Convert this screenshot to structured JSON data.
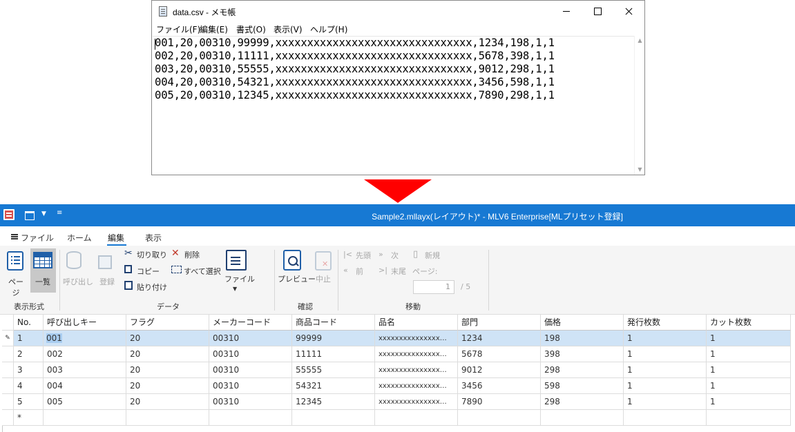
{
  "notepad": {
    "title": "data.csv - メモ帳",
    "menus": [
      "ファイル(F)",
      "編集(E)",
      "書式(O)",
      "表示(V)",
      "ヘルプ(H)"
    ],
    "lines": [
      "001,20,00310,99999,xxxxxxxxxxxxxxxxxxxxxxxxxxxxxxx,1234,198,1,1",
      "002,20,00310,11111,xxxxxxxxxxxxxxxxxxxxxxxxxxxxxxx,5678,398,1,1",
      "003,20,00310,55555,xxxxxxxxxxxxxxxxxxxxxxxxxxxxxxx,9012,298,1,1",
      "004,20,00310,54321,xxxxxxxxxxxxxxxxxxxxxxxxxxxxxxx,3456,598,1,1",
      "005,20,00310,12345,xxxxxxxxxxxxxxxxxxxxxxxxxxxxxxx,7890,298,1,1"
    ]
  },
  "arrow_color": "#ff0000",
  "app": {
    "title": "Sample2.mllayx(レイアウト)* - MLV6 Enterprise[MLプリセット登録]",
    "titlebar_color": "#1779d3",
    "tabs": [
      "ファイル",
      "ホーム",
      "編集",
      "表示"
    ],
    "active_tab": "編集",
    "ribbon": {
      "display_group": {
        "label": "表示形式",
        "page": "ページ",
        "list": "一覧"
      },
      "data_group": {
        "label": "データ",
        "call": "呼び出し",
        "register": "登録",
        "cut": "切り取り",
        "copy": "コピー",
        "paste": "貼り付け",
        "delete": "削除",
        "select_all": "すべて選択",
        "file": "ファイル"
      },
      "confirm_group": {
        "label": "確認",
        "preview": "プレビュー",
        "stop": "中止"
      },
      "move_group": {
        "label": "移動",
        "first": "先頭",
        "next": "次",
        "new": "新規",
        "prev": "前",
        "last": "末尾",
        "page": "ページ:",
        "page_value": "1",
        "page_total": "/ 5"
      }
    },
    "grid": {
      "columns": [
        "No.",
        "呼び出しキー",
        "フラグ",
        "メーカーコード",
        "商品コード",
        "品名",
        "部門",
        "価格",
        "発行枚数",
        "カット枚数"
      ],
      "rows": [
        [
          "1",
          "001",
          "20",
          "00310",
          "99999",
          "xxxxxxxxxxxxxxx…",
          "1234",
          "198",
          "1",
          "1"
        ],
        [
          "2",
          "002",
          "20",
          "00310",
          "11111",
          "xxxxxxxxxxxxxxx…",
          "5678",
          "398",
          "1",
          "1"
        ],
        [
          "3",
          "003",
          "20",
          "00310",
          "55555",
          "xxxxxxxxxxxxxxx…",
          "9012",
          "298",
          "1",
          "1"
        ],
        [
          "4",
          "004",
          "20",
          "00310",
          "54321",
          "xxxxxxxxxxxxxxx…",
          "3456",
          "598",
          "1",
          "1"
        ],
        [
          "5",
          "005",
          "20",
          "00310",
          "12345",
          "xxxxxxxxxxxxxxx…",
          "7890",
          "298",
          "1",
          "1"
        ]
      ],
      "new_row_marker": "*",
      "edit_marker": "✎"
    }
  }
}
